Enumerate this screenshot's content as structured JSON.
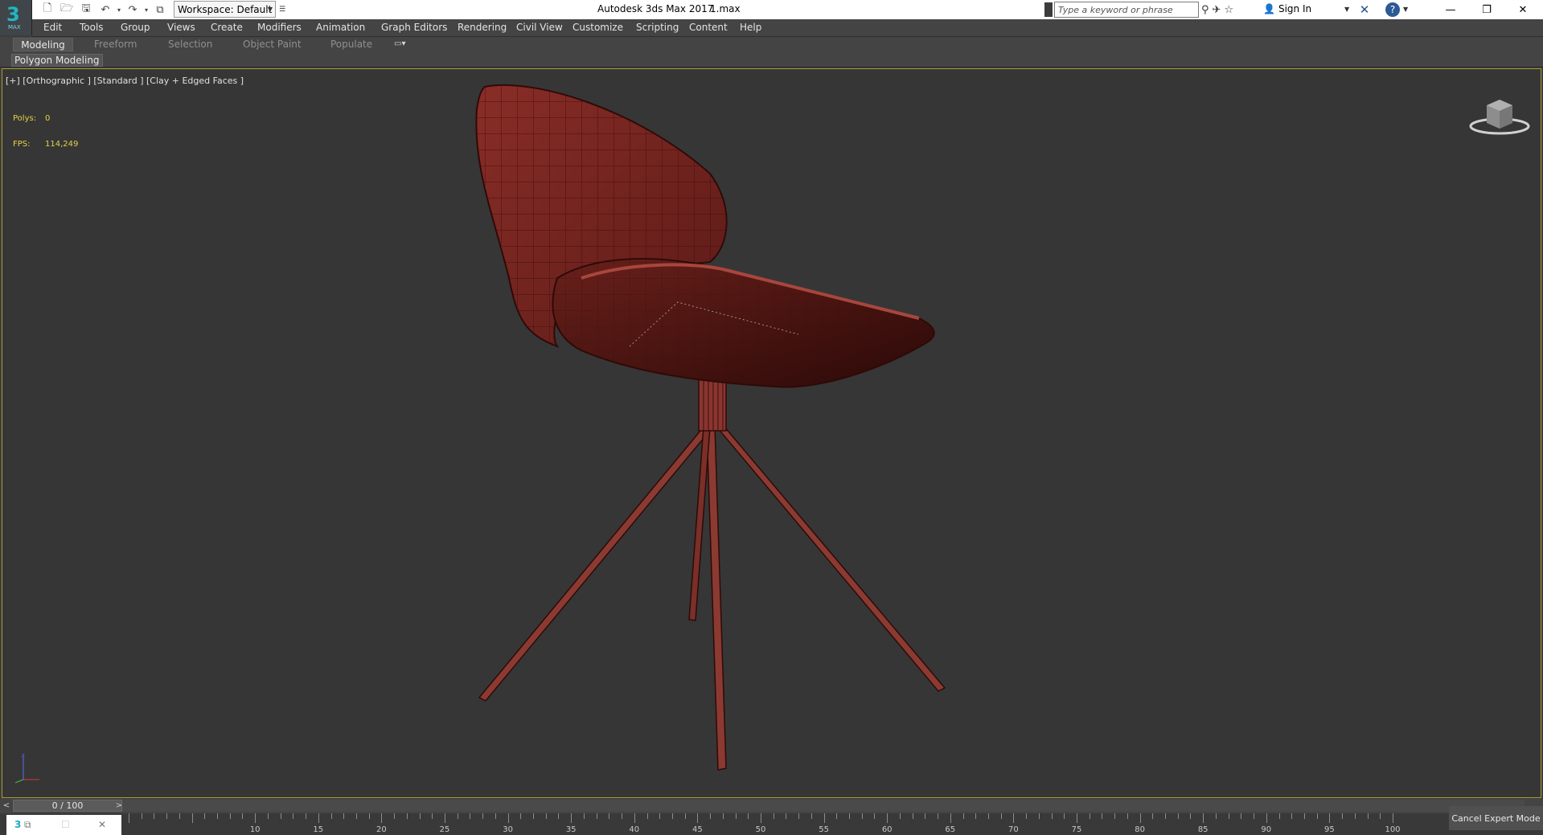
{
  "titlebar": {
    "workspace_label": "Workspace: Default",
    "app_title": "Autodesk 3ds Max 2017",
    "file_name": "1.max",
    "search_placeholder": "Type a keyword or phrase",
    "sign_in": "Sign In"
  },
  "menu": {
    "items": [
      "Edit",
      "Tools",
      "Group",
      "Views",
      "Create",
      "Modifiers",
      "Animation",
      "Graph Editors",
      "Rendering",
      "Civil View",
      "Customize",
      "Scripting",
      "Content",
      "Help"
    ]
  },
  "ribbon": {
    "tabs": [
      "Modeling",
      "Freeform",
      "Selection",
      "Object Paint",
      "Populate"
    ],
    "active_tab": "Modeling",
    "panel_label": "Polygon Modeling"
  },
  "viewport": {
    "label": "[+] [Orthographic ] [Standard ] [Clay + Edged Faces ]",
    "polys_label": "Polys:",
    "polys_value": "0",
    "fps_label": "FPS:",
    "fps_value": "114,249",
    "border_color": "#a79b35",
    "model_color": "#7a2722"
  },
  "timeline": {
    "frame_display": "0 / 100",
    "current_frame": 0,
    "total_frames": 100,
    "ticks": [
      "10",
      "15",
      "20",
      "25",
      "30",
      "35",
      "40",
      "45",
      "50",
      "55",
      "60",
      "65",
      "70",
      "75",
      "80",
      "85",
      "90",
      "95",
      "100"
    ]
  },
  "statusbar": {
    "cancel_expert_mode": "Cancel Expert Mode"
  }
}
